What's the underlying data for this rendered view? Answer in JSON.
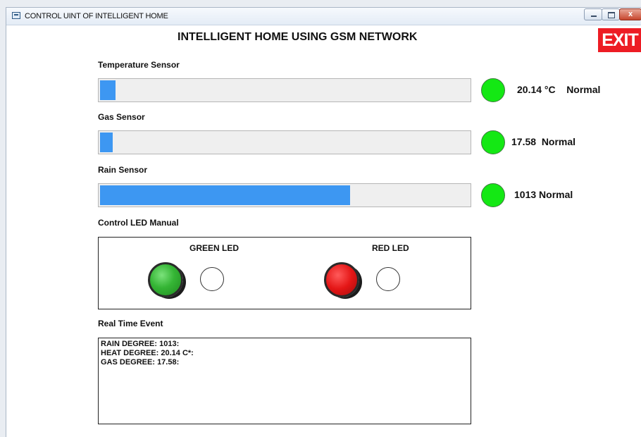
{
  "window": {
    "title": "CONTROL UINT OF INTELLIGENT HOME",
    "buttons": {
      "close_label": "x"
    }
  },
  "header": {
    "title": "INTELLIGENT HOME USING GSM NETWORK",
    "exit_label": "EXIT"
  },
  "sensors": [
    {
      "label": "Temperature Sensor",
      "value_text": "20.14 °C    Normal",
      "level_percent": 4.5,
      "indicator_color": "#14e814"
    },
    {
      "label": "Gas Sensor",
      "value_text": "17.58  Normal",
      "level_percent": 3.7,
      "indicator_color": "#14e814"
    },
    {
      "label": "Rain Sensor",
      "value_text": "1013 Normal",
      "level_percent": 67.6,
      "indicator_color": "#14e814"
    }
  ],
  "led_control": {
    "label": "Control LED Manual",
    "green": {
      "label": "GREEN LED",
      "color": "#35b535",
      "lamp_on": false
    },
    "red": {
      "label": "RED LED",
      "color": "#e41616",
      "lamp_on": false
    }
  },
  "events": {
    "label": "Real Time Event",
    "lines": [
      "RAIN DEGREE:  1013:",
      "HEAT DEGREE: 20.14 C*:",
      "GAS DEGREE: 17.58:"
    ]
  },
  "colors": {
    "bar_fill": "#3d97f2",
    "exit_bg": "#ed1c24"
  }
}
